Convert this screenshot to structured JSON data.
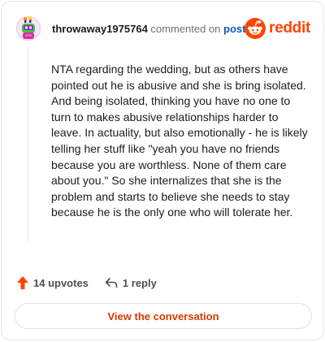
{
  "header": {
    "username": "throwaway1975764",
    "commented_text": "commented on",
    "post_link": "post",
    "brand_name": "reddit"
  },
  "comment": {
    "body": "NTA regarding the wedding, but as others have pointed out he is abusive and she is bring isolated. And being isolated, thinking you have no one to turn to makes abusive relationships harder to leave. In actuality, but also emotionally - he is likely telling her stuff like \"yeah you have no friends because you are worthless. None of them care about you.\" So she internalizes that she is the problem and starts to believe she needs to stay because he is the only one who will tolerate her."
  },
  "actions": {
    "upvotes_label": "14 upvotes",
    "reply_label": "1 reply",
    "upvote_icon": "upvote-arrow-icon",
    "reply_icon": "reply-arrow-icon"
  },
  "footer": {
    "view_button_label": "View the conversation"
  },
  "colors": {
    "brand": "#ff4500",
    "link": "#0f5ab8",
    "button_text": "#d93a00",
    "muted": "#6b6f72"
  }
}
